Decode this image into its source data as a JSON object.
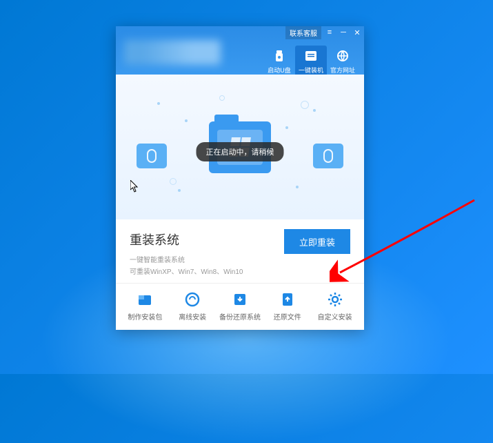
{
  "titlebar": {
    "contact_label": "联系客服"
  },
  "nav": {
    "tabs": [
      {
        "label": "启动U盘"
      },
      {
        "label": "一键装机"
      },
      {
        "label": "官方网址"
      }
    ]
  },
  "hero": {
    "toast": "正在启动中，请稍候"
  },
  "content": {
    "title": "重装系统",
    "subtitle1": "一键智能重装系统",
    "subtitle2": "可重装WinXP、Win7、Win8、Win10",
    "primary_button": "立即重装"
  },
  "toolbar": {
    "items": [
      {
        "label": "制作安装包"
      },
      {
        "label": "离线安装"
      },
      {
        "label": "备份还原系统"
      },
      {
        "label": "还原文件"
      },
      {
        "label": "自定义安装"
      }
    ]
  }
}
